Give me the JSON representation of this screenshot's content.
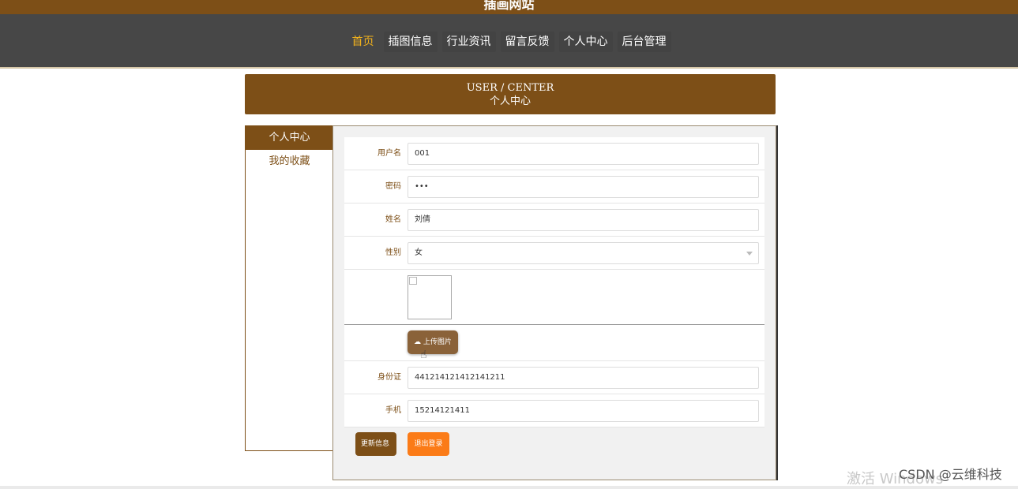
{
  "site": {
    "title": "插画网站"
  },
  "nav": [
    {
      "label": "首页",
      "active": true
    },
    {
      "label": "插图信息"
    },
    {
      "label": "行业资讯"
    },
    {
      "label": "留言反馈"
    },
    {
      "label": "个人中心"
    },
    {
      "label": "后台管理"
    }
  ],
  "banner": {
    "en": "USER / CENTER",
    "cn": "个人中心"
  },
  "sidebar": [
    {
      "label": "个人中心",
      "active": true
    },
    {
      "label": "我的收藏"
    }
  ],
  "form": {
    "username": {
      "label": "用户名",
      "value": "001"
    },
    "password": {
      "label": "密码",
      "value": "•••"
    },
    "name": {
      "label": "姓名",
      "value": "刘倩"
    },
    "gender": {
      "label": "性别",
      "value": "女"
    },
    "upload_label": "上传图片",
    "idcard": {
      "label": "身份证",
      "value": "441214121412141211"
    },
    "phone": {
      "label": "手机",
      "value": "15214121411"
    }
  },
  "actions": {
    "update": "更新信息",
    "logout": "退出登录"
  },
  "overlay": {
    "watermark": "激活 Windows",
    "credit": "CSDN @云维科技"
  },
  "colors": {
    "brand": "#7d4f17",
    "nav_bg": "#474747",
    "active_nav": "#f2b21c",
    "logout": "#fb7b17"
  }
}
